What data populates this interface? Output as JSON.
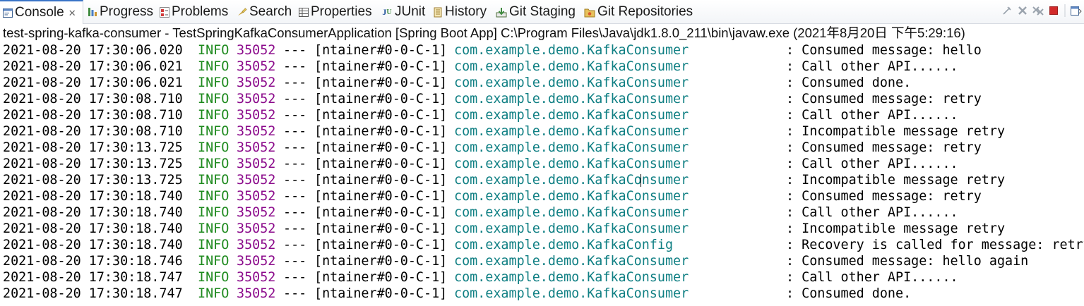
{
  "tabs": [
    {
      "label": "Console",
      "icon": "console-icon",
      "active": true,
      "closable": true
    },
    {
      "label": "Progress",
      "icon": "progress-icon"
    },
    {
      "label": "Problems",
      "icon": "problems-icon"
    },
    {
      "label": "Search",
      "icon": "search-icon"
    },
    {
      "label": "Properties",
      "icon": "properties-icon"
    },
    {
      "label": "JUnit",
      "icon": "junit-icon"
    },
    {
      "label": "History",
      "icon": "history-icon"
    },
    {
      "label": "Git Staging",
      "icon": "git-staging-icon"
    },
    {
      "label": "Git Repositories",
      "icon": "git-repositories-icon"
    }
  ],
  "toolbar": {
    "icons": [
      "pin-icon",
      "remove-launch-icon",
      "remove-all-terminated-icon",
      "terminate-icon",
      "display-console-icon"
    ],
    "terminate_color": "#d22a2a"
  },
  "console": {
    "description": "test-spring-kafka-consumer - TestSpringKafkaConsumerApplication [Spring Boot App] C:\\Program Files\\Java\\jdk1.8.0_211\\bin\\javaw.exe (2021年8月20日 下午5:29:16)",
    "colors": {
      "level": "#1e8a1e",
      "pid": "#8b0a8b",
      "logger": "#0f7f83"
    },
    "lines": [
      {
        "ts": "2021-08-20 17:30:06.020",
        "level": "INFO",
        "pid": "35052",
        "sep": "---",
        "thread": "[ntainer#0-0-C-1]",
        "logger": "com.example.demo.KafkaConsumer",
        "msg": ": Consumed message: hello"
      },
      {
        "ts": "2021-08-20 17:30:06.021",
        "level": "INFO",
        "pid": "35052",
        "sep": "---",
        "thread": "[ntainer#0-0-C-1]",
        "logger": "com.example.demo.KafkaConsumer",
        "msg": ": Call other API......"
      },
      {
        "ts": "2021-08-20 17:30:06.021",
        "level": "INFO",
        "pid": "35052",
        "sep": "---",
        "thread": "[ntainer#0-0-C-1]",
        "logger": "com.example.demo.KafkaConsumer",
        "msg": ": Consumed done."
      },
      {
        "ts": "2021-08-20 17:30:08.710",
        "level": "INFO",
        "pid": "35052",
        "sep": "---",
        "thread": "[ntainer#0-0-C-1]",
        "logger": "com.example.demo.KafkaConsumer",
        "msg": ": Consumed message: retry"
      },
      {
        "ts": "2021-08-20 17:30:08.710",
        "level": "INFO",
        "pid": "35052",
        "sep": "---",
        "thread": "[ntainer#0-0-C-1]",
        "logger": "com.example.demo.KafkaConsumer",
        "msg": ": Call other API......"
      },
      {
        "ts": "2021-08-20 17:30:08.710",
        "level": "INFO",
        "pid": "35052",
        "sep": "---",
        "thread": "[ntainer#0-0-C-1]",
        "logger": "com.example.demo.KafkaConsumer",
        "msg": ": Incompatible message retry"
      },
      {
        "ts": "2021-08-20 17:30:13.725",
        "level": "INFO",
        "pid": "35052",
        "sep": "---",
        "thread": "[ntainer#0-0-C-1]",
        "logger": "com.example.demo.KafkaConsumer",
        "msg": ": Consumed message: retry"
      },
      {
        "ts": "2021-08-20 17:30:13.725",
        "level": "INFO",
        "pid": "35052",
        "sep": "---",
        "thread": "[ntainer#0-0-C-1]",
        "logger": "com.example.demo.KafkaConsumer",
        "msg": ": Call other API......"
      },
      {
        "ts": "2021-08-20 17:30:13.725",
        "level": "INFO",
        "pid": "35052",
        "sep": "---",
        "thread": "[ntainer#0-0-C-1]",
        "logger": "com.example.demo.KafkaConsumer",
        "msg": ": Incompatible message retry"
      },
      {
        "ts": "2021-08-20 17:30:18.740",
        "level": "INFO",
        "pid": "35052",
        "sep": "---",
        "thread": "[ntainer#0-0-C-1]",
        "logger": "com.example.demo.KafkaConsumer",
        "msg": ": Consumed message: retry"
      },
      {
        "ts": "2021-08-20 17:30:18.740",
        "level": "INFO",
        "pid": "35052",
        "sep": "---",
        "thread": "[ntainer#0-0-C-1]",
        "logger": "com.example.demo.KafkaConsumer",
        "msg": ": Call other API......"
      },
      {
        "ts": "2021-08-20 17:30:18.740",
        "level": "INFO",
        "pid": "35052",
        "sep": "---",
        "thread": "[ntainer#0-0-C-1]",
        "logger": "com.example.demo.KafkaConsumer",
        "msg": ": Incompatible message retry"
      },
      {
        "ts": "2021-08-20 17:30:18.740",
        "level": "INFO",
        "pid": "35052",
        "sep": "---",
        "thread": "[ntainer#0-0-C-1]",
        "logger": "com.example.demo.KafkaConfig",
        "msg": ": Recovery is called for message: retry"
      },
      {
        "ts": "2021-08-20 17:30:18.746",
        "level": "INFO",
        "pid": "35052",
        "sep": "---",
        "thread": "[ntainer#0-0-C-1]",
        "logger": "com.example.demo.KafkaConsumer",
        "msg": ": Consumed message: hello again"
      },
      {
        "ts": "2021-08-20 17:30:18.747",
        "level": "INFO",
        "pid": "35052",
        "sep": "---",
        "thread": "[ntainer#0-0-C-1]",
        "logger": "com.example.demo.KafkaConsumer",
        "msg": ": Call other API......"
      },
      {
        "ts": "2021-08-20 17:30:18.747",
        "level": "INFO",
        "pid": "35052",
        "sep": "---",
        "thread": "[ntainer#0-0-C-1]",
        "logger": "com.example.demo.KafkaConsumer",
        "msg": ": Consumed done."
      }
    ]
  }
}
